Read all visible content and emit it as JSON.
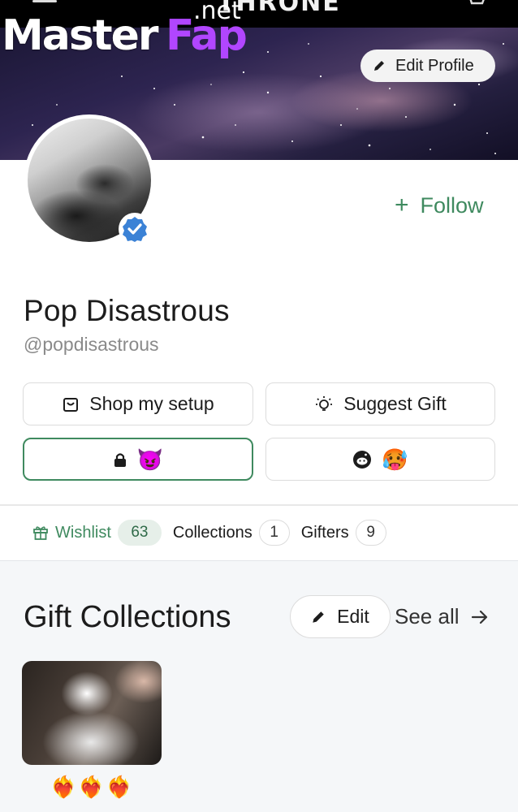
{
  "header": {
    "brand": "THRONE",
    "menu_icon": "hamburger-menu-icon",
    "cart_icon": "cart-icon"
  },
  "watermark": {
    "part1": "Master",
    "part2": "Fap",
    "part3": ".net"
  },
  "profile": {
    "edit_profile_label": "Edit Profile",
    "follow_label": "Follow",
    "name": "Pop Disastrous",
    "handle": "@popdisastrous",
    "verified": true
  },
  "actions": {
    "shop_label": "Shop my setup",
    "suggest_label": "Suggest Gift",
    "locked_emoji": "😈",
    "reddit_emoji": "🥵"
  },
  "tabs": [
    {
      "label": "Wishlist",
      "count": "63",
      "active": true
    },
    {
      "label": "Collections",
      "count": "1",
      "active": false
    },
    {
      "label": "Gifters",
      "count": "9",
      "active": false
    }
  ],
  "gift_collections": {
    "title": "Gift Collections",
    "edit_label": "Edit",
    "see_all_label": "See all",
    "items": [
      {
        "label": "❤️‍🔥❤️‍🔥❤️‍🔥"
      }
    ]
  },
  "colors": {
    "accent": "#3f8a5f",
    "verified": "#3b82d6"
  }
}
